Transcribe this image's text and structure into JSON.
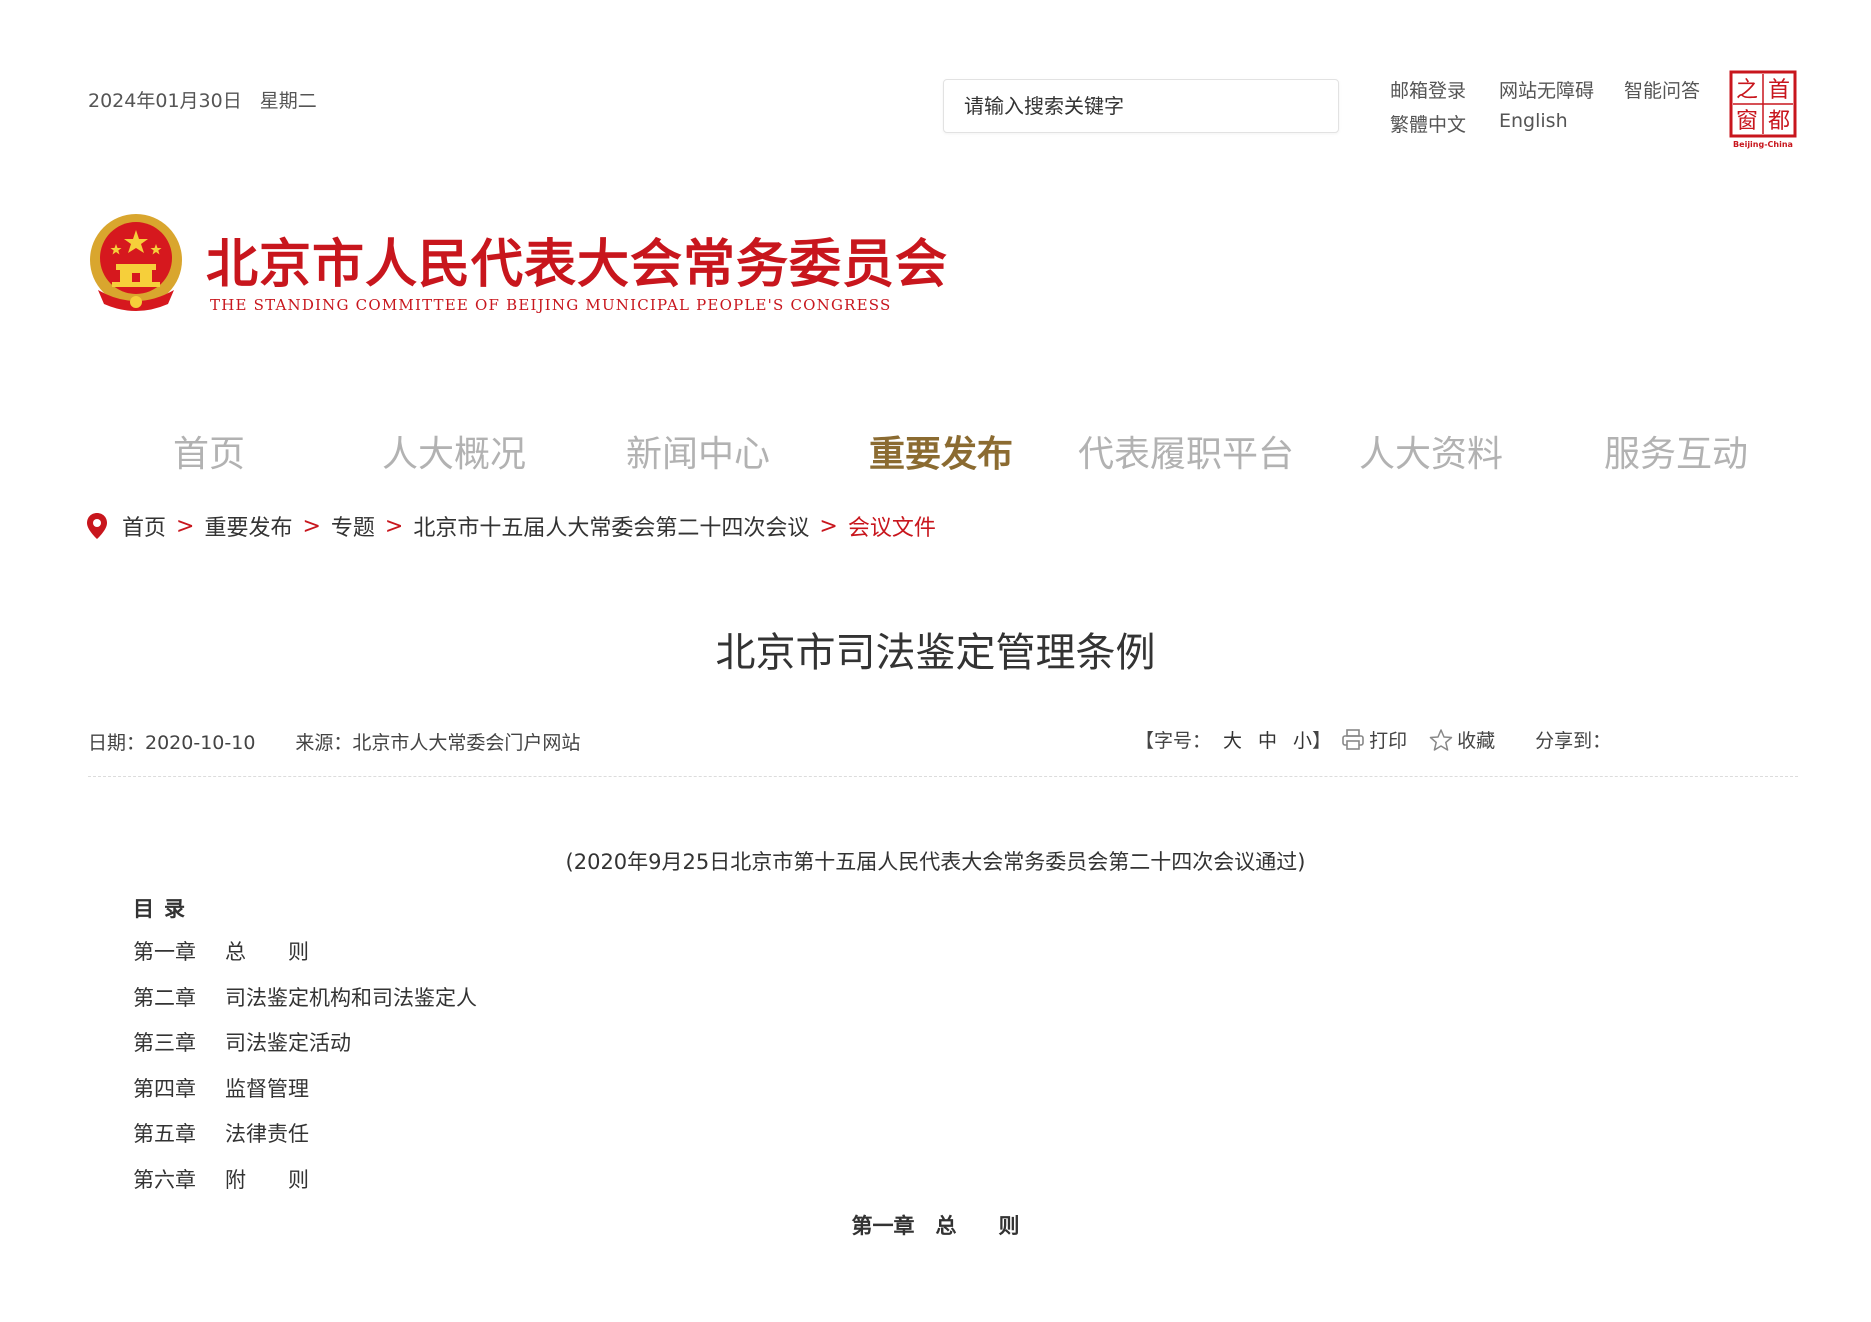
{
  "topbar": {
    "date": "2024年01月30日",
    "weekday": "星期二",
    "search_placeholder": "请输入搜索关键字",
    "links": [
      "邮箱登录",
      "网站无障碍",
      "智能问答",
      "繁體中文",
      "English"
    ],
    "seal_chars": [
      "首",
      "都",
      "之",
      "窗"
    ],
    "seal_caption": "Beijing-China"
  },
  "header": {
    "title": "北京市人民代表大会常务委员会",
    "subtitle": "THE STANDING COMMITTEE OF BEIJING MUNICIPAL PEOPLE'S CONGRESS"
  },
  "nav": {
    "items": [
      "首页",
      "人大概况",
      "新闻中心",
      "重要发布",
      "代表履职平台",
      "人大资料",
      "服务互动"
    ],
    "active_index": 3
  },
  "breadcrumb": {
    "items": [
      "首页",
      "重要发布",
      "专题",
      "北京市十五届人大常委会第二十四次会议"
    ],
    "separator": ">",
    "current": "会议文件"
  },
  "article": {
    "title": "北京市司法鉴定管理条例",
    "date_label": "日期：2020-10-10",
    "source_label": "来源：北京市人大常委会门户网站",
    "font_size_label": "【字号：",
    "font_sizes": [
      "大",
      "中",
      "小"
    ],
    "font_size_close": "】",
    "print_label": "打印",
    "favorite_label": "收藏",
    "share_label": "分享到：",
    "passed_note": "(2020年9月25日北京市第十五届人民代表大会常务委员会第二十四次会议通过)",
    "toc_heading": "目录",
    "toc": [
      {
        "chapter": "第一章",
        "title": "总　　则"
      },
      {
        "chapter": "第二章",
        "title": "司法鉴定机构和司法鉴定人"
      },
      {
        "chapter": "第三章",
        "title": "司法鉴定活动"
      },
      {
        "chapter": "第四章",
        "title": "监督管理"
      },
      {
        "chapter": "第五章",
        "title": "法律责任"
      },
      {
        "chapter": "第六章",
        "title": "附　　则"
      }
    ],
    "first_chapter_heading": "第一章　总　　则"
  },
  "colors": {
    "brand_red": "#c8161d",
    "nav_active": "#8b6b31",
    "nav_inactive": "#b2b2b2"
  }
}
